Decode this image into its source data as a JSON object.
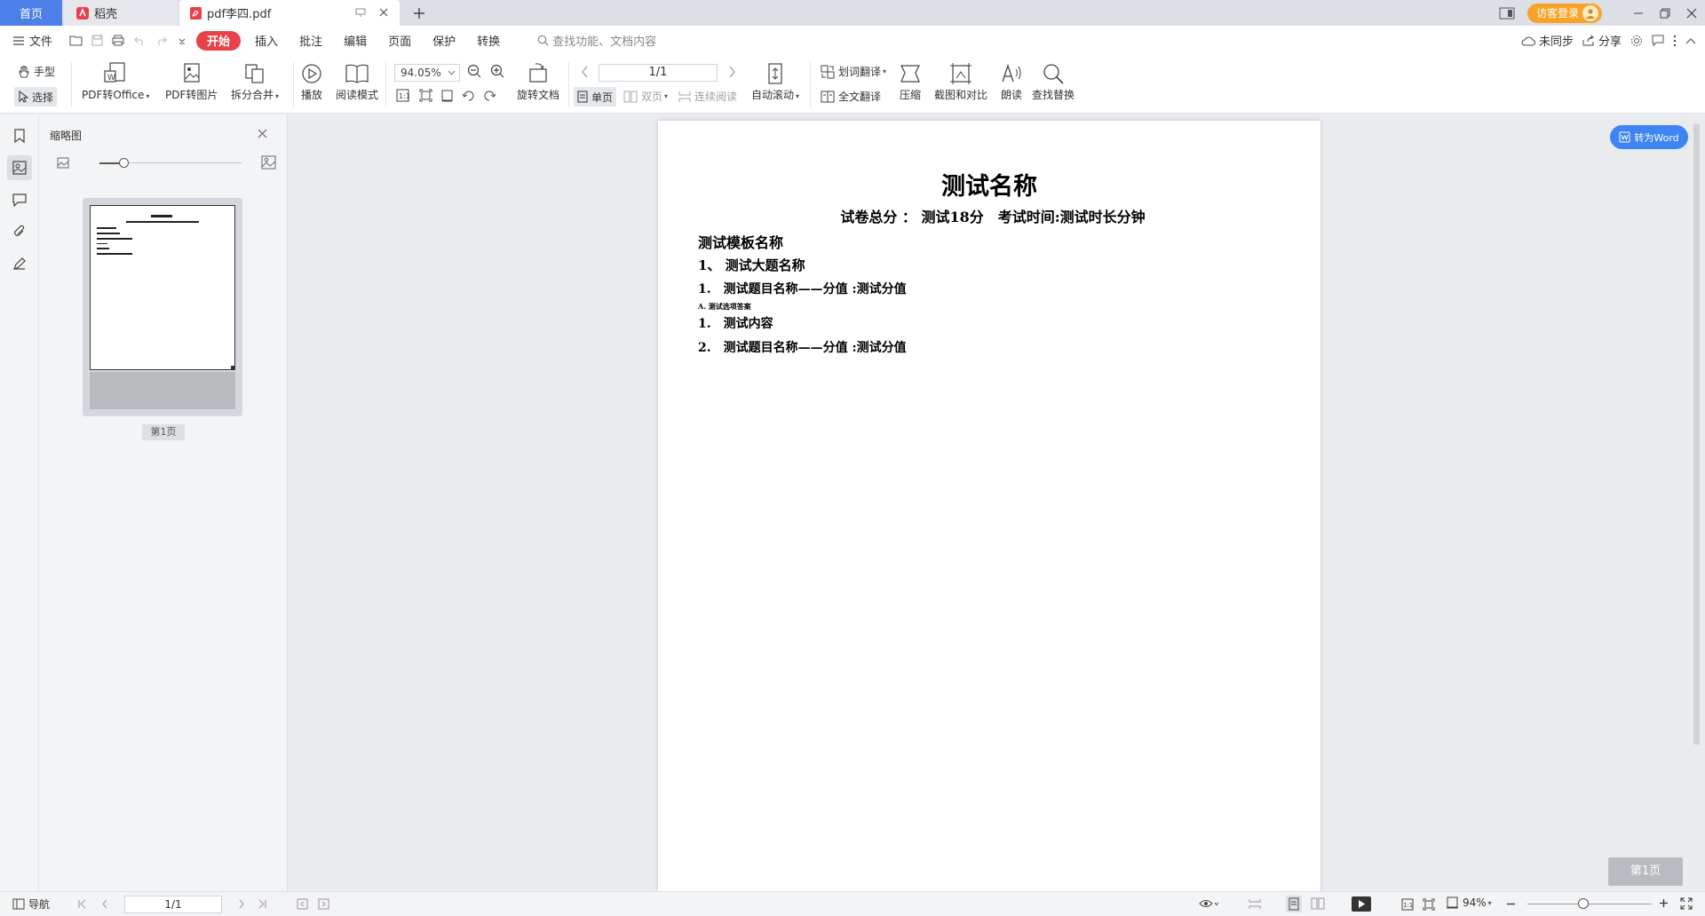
{
  "tabs": {
    "home": "首页",
    "daoke": "稻壳",
    "pdf": "pdf李四.pdf"
  },
  "login": "访客登录",
  "menu": {
    "file": "文件",
    "tabs": [
      "开始",
      "插入",
      "批注",
      "编辑",
      "页面",
      "保护",
      "转换"
    ],
    "search_placeholder": "查找功能、文档内容",
    "sync": "未同步",
    "share": "分享"
  },
  "ribbon": {
    "hand": "手型",
    "select": "选择",
    "pdf_to_office": "PDF转Office",
    "pdf_to_image": "PDF转图片",
    "split_merge": "拆分合并",
    "play": "播放",
    "read_mode": "阅读模式",
    "zoom": "94.05%",
    "rotate_doc": "旋转文档",
    "page_num": "1/1",
    "single": "单页",
    "double": "双页",
    "continuous": "连续阅读",
    "auto_scroll": "自动滚动",
    "word_translate": "划词翻译",
    "full_translate": "全文翻译",
    "compress": "压缩",
    "screenshot_compare": "截图和对比",
    "read_aloud": "朗读",
    "find_replace": "查找替换"
  },
  "thumbnail": {
    "title": "缩略图",
    "page_label": "第1页"
  },
  "document": {
    "title": "测试名称",
    "subtitle": "试卷总分 ： 测试18分　考试时间:测试时长分钟",
    "template": "测试模板名称",
    "section": "1、 测试大题名称",
    "q1": "1.　测试题目名称——分值 :测试分值",
    "option": "A. 测试选项答案",
    "content": "1.　测试内容",
    "q2": "2.　测试题目名称——分值 :测试分值"
  },
  "to_word": "转为Word",
  "page_indicator": "第1页",
  "status": {
    "nav": "导航",
    "page": "1/1",
    "zoom": "94%"
  },
  "colors": {
    "accent": "#4c80e8",
    "start_tab": "#e8414a",
    "login": "#f6a52a",
    "to_word": "#3f84f3"
  }
}
